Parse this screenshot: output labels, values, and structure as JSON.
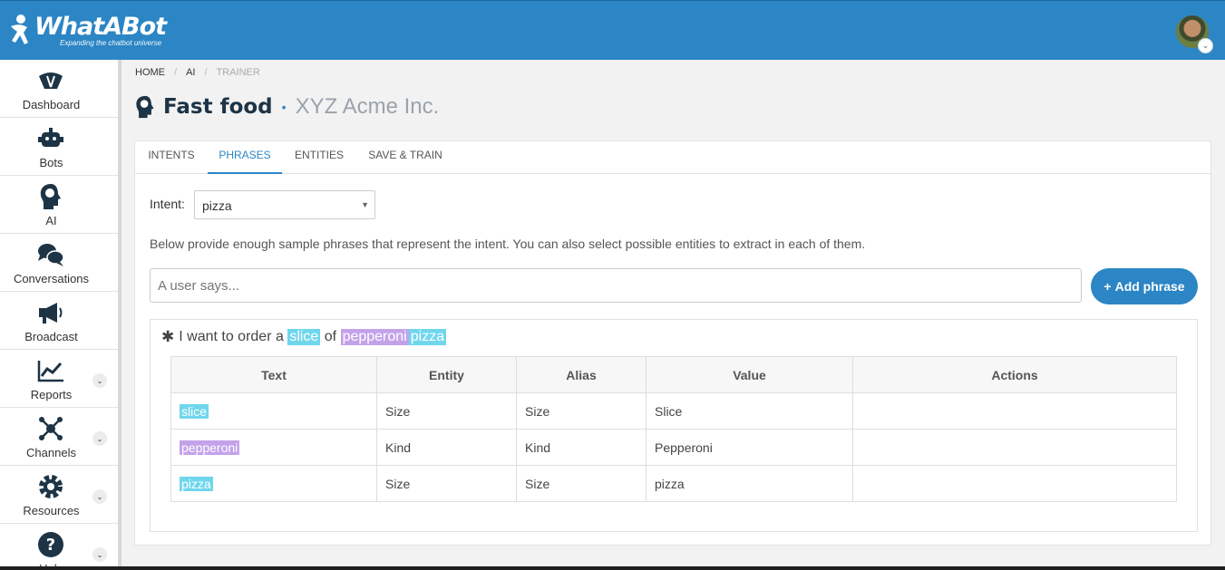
{
  "brand": {
    "title": "WhatABot",
    "tagline": "Expanding the chatbot universe",
    "primary_color": "#2c85c4"
  },
  "user_menu": {
    "avatar": "user-avatar",
    "caret": "⌄"
  },
  "sidebar": {
    "items": [
      {
        "label": "Dashboard",
        "icon": "dashboard-icon",
        "expandable": false
      },
      {
        "label": "Bots",
        "icon": "robot-icon",
        "expandable": false
      },
      {
        "label": "AI",
        "icon": "brain-head-icon",
        "expandable": false
      },
      {
        "label": "Conversations",
        "icon": "chat-bubbles-icon",
        "expandable": false
      },
      {
        "label": "Broadcast",
        "icon": "megaphone-icon",
        "expandable": false
      },
      {
        "label": "Reports",
        "icon": "line-chart-icon",
        "expandable": true
      },
      {
        "label": "Channels",
        "icon": "network-icon",
        "expandable": true
      },
      {
        "label": "Resources",
        "icon": "gear-icon",
        "expandable": true
      },
      {
        "label": "Help",
        "icon": "question-icon",
        "expandable": true
      }
    ]
  },
  "breadcrumb": {
    "home": "HOME",
    "ai": "AI",
    "current": "TRAINER",
    "sep": "/"
  },
  "page": {
    "title": "Fast food",
    "dot": "•",
    "subtitle": "XYZ Acme Inc."
  },
  "tabs": [
    {
      "label": "INTENTS",
      "active": false
    },
    {
      "label": "PHRASES",
      "active": true
    },
    {
      "label": "ENTITIES",
      "active": false
    },
    {
      "label": "SAVE & TRAIN",
      "active": false
    }
  ],
  "intent": {
    "label": "Intent:",
    "selected": "pizza"
  },
  "helper_text": "Below provide enough sample phrases that represent the intent. You can also select possible entities to extract in each of them.",
  "phrase_input": {
    "placeholder": "A user says...",
    "value": ""
  },
  "add_button": {
    "label": "Add phrase",
    "icon": "+"
  },
  "phrase": {
    "prefix": "I want to order a ",
    "t1": "slice",
    "mid": " of ",
    "t2": "pepperoni",
    "t3": "pizza",
    "colors": {
      "Size": "#6fd6ec",
      "Kind": "#c3a2ea"
    }
  },
  "entities_table": {
    "headers": [
      "Text",
      "Entity",
      "Alias",
      "Value",
      "Actions"
    ],
    "rows": [
      {
        "text": "slice",
        "entity": "Size",
        "alias": "Size",
        "value": "Slice",
        "actions": ""
      },
      {
        "text": "pepperoni",
        "entity": "Kind",
        "alias": "Kind",
        "value": "Pepperoni",
        "actions": ""
      },
      {
        "text": "pizza",
        "entity": "Size",
        "alias": "Size",
        "value": "pizza",
        "actions": ""
      }
    ]
  }
}
